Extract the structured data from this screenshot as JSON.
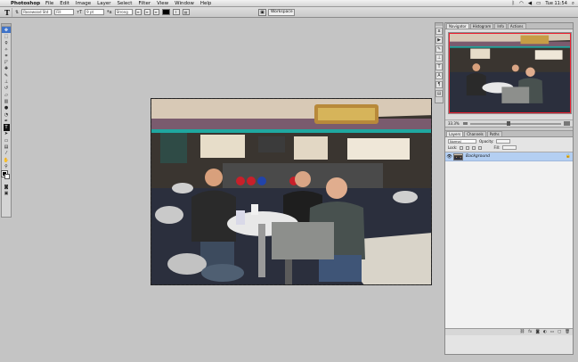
{
  "menubar": {
    "apple": "",
    "app_name": "Photoshop",
    "items": [
      "File",
      "Edit",
      "Image",
      "Layer",
      "Select",
      "Filter",
      "View",
      "Window",
      "Help"
    ],
    "clock": "Tue 11:54"
  },
  "options": {
    "tool_letter": "T",
    "font_family": "Rosewood Std",
    "font_style": "Fill",
    "font_size": "9 pt",
    "anti_alias": "Strong",
    "workspace": "Workspace"
  },
  "navigator": {
    "tabs": [
      "Navigator",
      "Histogram",
      "Info",
      "Actions"
    ],
    "zoom": "33.3%"
  },
  "layers": {
    "tabs": [
      "Layers",
      "Channels",
      "Paths"
    ],
    "blend_mode": "Normal",
    "opacity_label": "Opacity:",
    "lock_label": "Lock:",
    "fill_label": "Fill:",
    "rows": [
      {
        "name": "Background"
      }
    ]
  },
  "colors": {
    "selection": "#b4cff2",
    "active_tool": "#3f73c8",
    "view_box": "#e23"
  }
}
